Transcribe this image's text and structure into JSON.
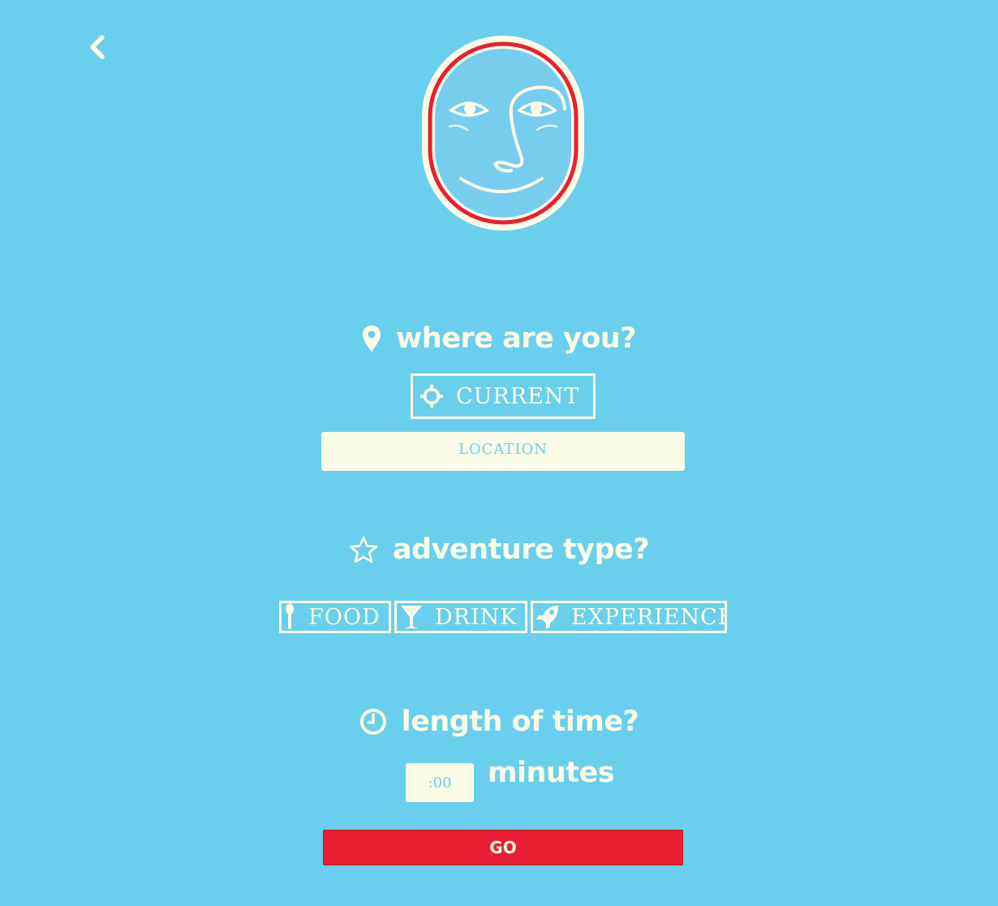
{
  "nav": {
    "back_icon": "chevron-left-icon"
  },
  "logo": {
    "icon": "smiling-face-logo",
    "colors": {
      "outer": "#fbfce8",
      "ring": "#e8202f",
      "face": "#74cdee"
    }
  },
  "where": {
    "heading": "where are you?",
    "icon": "map-marker-icon",
    "current_button": {
      "label": "CURRENT",
      "icon": "crosshair-icon"
    },
    "location_input": {
      "placeholder": "LOCATION",
      "value": ""
    }
  },
  "adventure": {
    "heading": "adventure type?",
    "icon": "star-outline-icon",
    "types": [
      {
        "label": "FOOD",
        "icon": "spoon-icon"
      },
      {
        "label": "DRINK",
        "icon": "cocktail-icon"
      },
      {
        "label": "EXPERIENCE",
        "icon": "rocket-icon"
      }
    ]
  },
  "time": {
    "heading": "length of time?",
    "icon": "clock-icon",
    "minutes_input": {
      "placeholder": ":00",
      "value": ""
    },
    "minutes_label": "minutes"
  },
  "go_button": {
    "label": "GO"
  },
  "colors": {
    "background": "#69cfed",
    "cream": "#fbfce8",
    "accent_red": "#ea1e32"
  }
}
